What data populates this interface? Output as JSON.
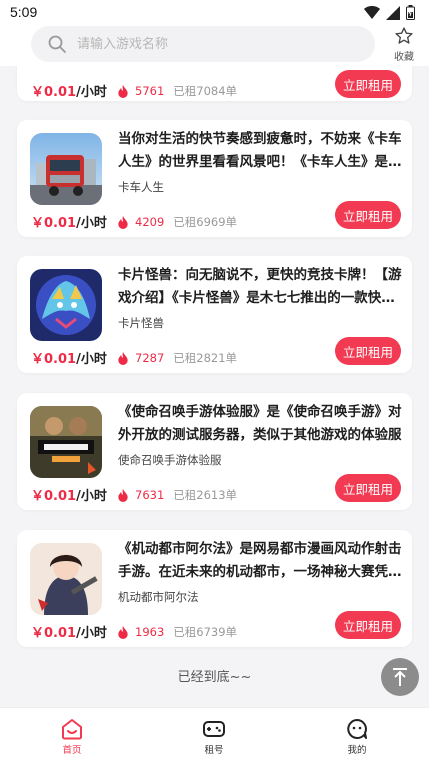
{
  "status_bar": {
    "time": "5:09"
  },
  "search": {
    "placeholder": "请输入游戏名称"
  },
  "favorites": {
    "label": "收藏"
  },
  "accent_color": "#f23b52",
  "cards": [
    {
      "description": "",
      "game_name": "",
      "price": "￥0.01",
      "unit": "/小时",
      "heat": "5761",
      "rented": "已租7084单",
      "button": "立即租用"
    },
    {
      "description": "当你对生活的快节奏感到疲惫时，不妨来《卡车人生》的世界里看看风景吧！《卡车人生》是一款卡车模拟驾驶游戏",
      "game_name": "卡车人生",
      "price": "￥0.01",
      "unit": "/小时",
      "heat": "4209",
      "rented": "已租6969单",
      "button": "立即租用"
    },
    {
      "description": "卡片怪兽：向无脑说不，更快的竞技卡牌！【游戏介绍】《卡片怪兽》是木七七推出的一款快节奏竞技卡牌游戏",
      "game_name": "卡片怪兽",
      "price": "￥0.01",
      "unit": "/小时",
      "heat": "7287",
      "rented": "已租2821单",
      "button": "立即租用"
    },
    {
      "description": "《使命召唤手游体验服》是《使命召唤手游》对外开放的测试服务器，类似于其他游戏的体验服",
      "game_name": "使命召唤手游体验服",
      "price": "￥0.01",
      "unit": "/小时",
      "heat": "7631",
      "rented": "已租2613单",
      "button": "立即租用"
    },
    {
      "description": "《机动都市阿尔法》是网易都市漫画风动作射击手游。在近未来的机动都市，一场神秘大赛凭借其独特的魅力",
      "game_name": "机动都市阿尔法",
      "price": "￥0.01",
      "unit": "/小时",
      "heat": "1963",
      "rented": "已租6739单",
      "button": "立即租用"
    }
  ],
  "end_of_list": "已经到底~~",
  "tabs": [
    {
      "label": "首页",
      "icon": "home-icon",
      "active": true
    },
    {
      "label": "租号",
      "icon": "gamepad-icon",
      "active": false
    },
    {
      "label": "我的",
      "icon": "profile-icon",
      "active": false
    }
  ]
}
